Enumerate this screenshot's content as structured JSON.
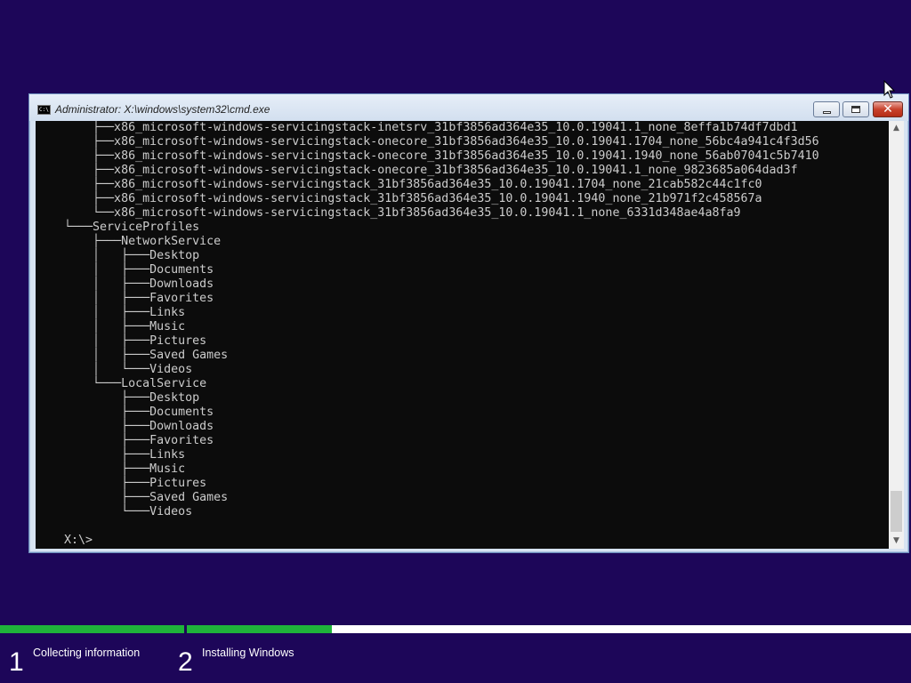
{
  "window": {
    "title": "Administrator: X:\\windows\\system32\\cmd.exe",
    "icon_text": "C:\\",
    "close_glyph": "✕"
  },
  "console": {
    "lines": [
      "    ├──x86_microsoft-windows-servicingstack-inetsrv_31bf3856ad364e35_10.0.19041.1_none_8effa1b74df7dbd1",
      "    ├──x86_microsoft-windows-servicingstack-onecore_31bf3856ad364e35_10.0.19041.1704_none_56bc4a941c4f3d56",
      "    ├──x86_microsoft-windows-servicingstack-onecore_31bf3856ad364e35_10.0.19041.1940_none_56ab07041c5b7410",
      "    ├──x86_microsoft-windows-servicingstack-onecore_31bf3856ad364e35_10.0.19041.1_none_9823685a064dad3f",
      "    ├──x86_microsoft-windows-servicingstack_31bf3856ad364e35_10.0.19041.1704_none_21cab582c44c1fc0",
      "    ├──x86_microsoft-windows-servicingstack_31bf3856ad364e35_10.0.19041.1940_none_21b971f2c458567a",
      "    └──x86_microsoft-windows-servicingstack_31bf3856ad364e35_10.0.19041.1_none_6331d348ae4a8fa9",
      "└───ServiceProfiles",
      "    ├───NetworkService",
      "    │   ├───Desktop",
      "    │   ├───Documents",
      "    │   ├───Downloads",
      "    │   ├───Favorites",
      "    │   ├───Links",
      "    │   ├───Music",
      "    │   ├───Pictures",
      "    │   ├───Saved Games",
      "    │   └───Videos",
      "    └───LocalService",
      "        ├───Desktop",
      "        ├───Documents",
      "        ├───Downloads",
      "        ├───Favorites",
      "        ├───Links",
      "        ├───Music",
      "        ├───Pictures",
      "        ├───Saved Games",
      "        └───Videos",
      "",
      "X:\\>"
    ],
    "line_prefix": "    ",
    "text_color": "#cccccc",
    "background": "#0c0c0c"
  },
  "setup": {
    "steps": [
      {
        "number": "1",
        "label": "Collecting information",
        "progress": 1.0
      },
      {
        "number": "2",
        "label": "Installing Windows",
        "progress": 0.2
      }
    ],
    "accent": "#1fb33a",
    "background": "#1d0659"
  },
  "icons": {
    "cursor": "mouse-pointer-icon",
    "scroll_up": "scroll-up-arrow-icon",
    "scroll_down": "scroll-down-arrow-icon"
  }
}
